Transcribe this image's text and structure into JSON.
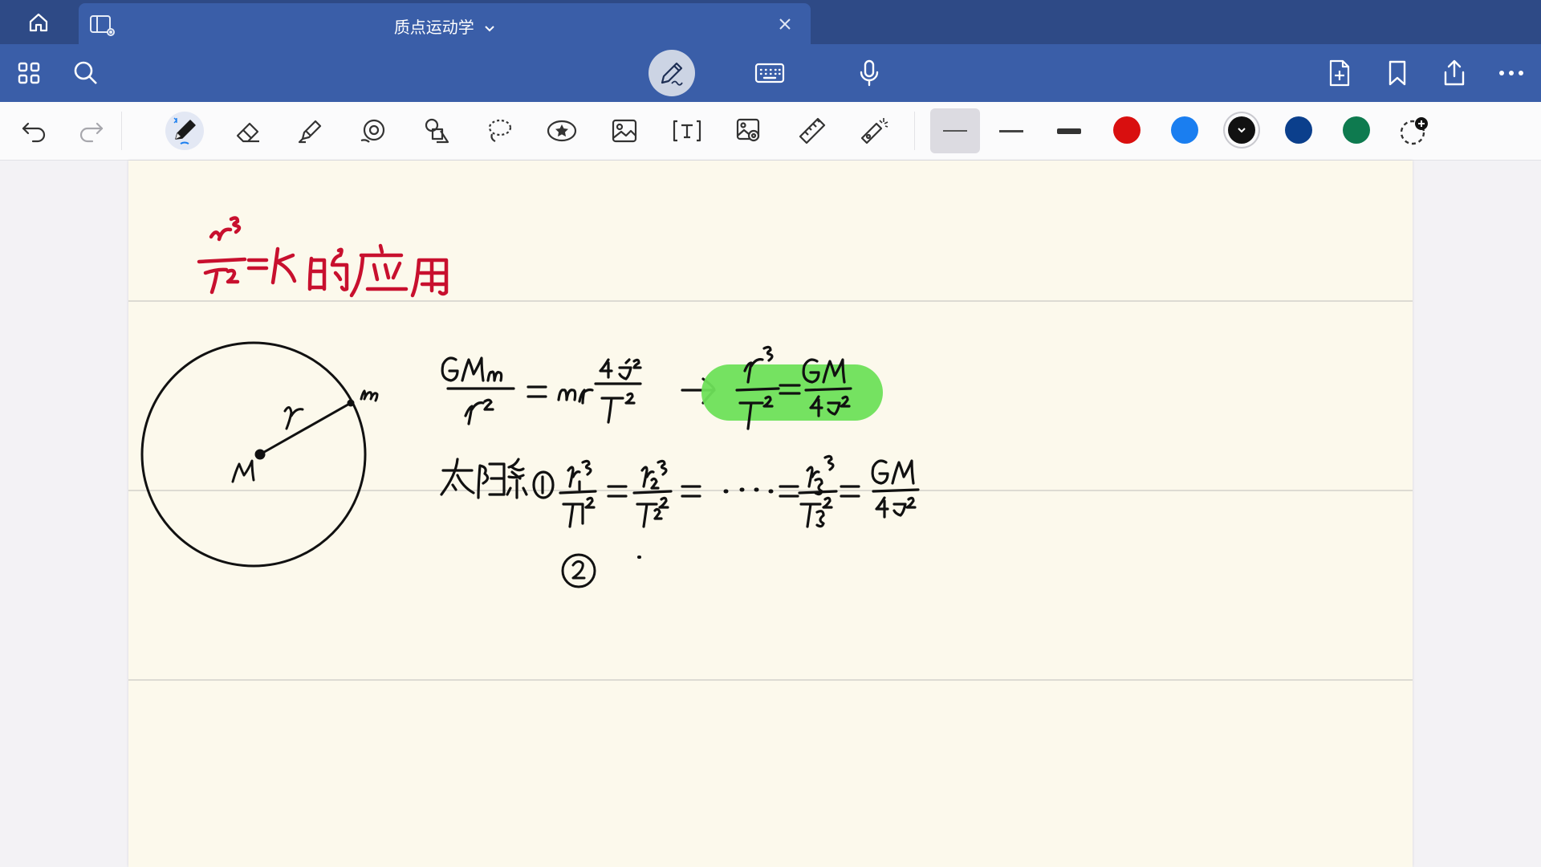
{
  "tab": {
    "title": "质点运动学"
  },
  "colors": {
    "tabbar_bg": "#2e4a86",
    "navbar_bg": "#3a5ea8",
    "page_bg": "#fcf9ec",
    "ink_red": "#c8102e",
    "ink_black": "#111111",
    "highlight": "#6ee05a"
  },
  "icons": {
    "tab": [
      "home-icon",
      "panel-icon",
      "chevron-down-icon",
      "close-icon"
    ],
    "nav_left": [
      "grid-icon",
      "search-icon"
    ],
    "nav_center": [
      "pen-mode-icon",
      "keyboard-icon",
      "microphone-icon"
    ],
    "nav_right": [
      "add-page-icon",
      "bookmark-icon",
      "share-icon",
      "more-icon"
    ],
    "tools": [
      "undo-icon",
      "redo-icon",
      "pen-icon",
      "eraser-icon",
      "highlighter-icon",
      "shape-icon",
      "elements-icon",
      "lasso-icon",
      "sticker-icon",
      "image-icon",
      "text-icon",
      "camera-icon",
      "ruler-icon",
      "laser-pointer-icon"
    ]
  },
  "stroke_widths": [
    "thin",
    "medium",
    "thick"
  ],
  "selected_stroke": "thin",
  "pen_colors": [
    "#d90f0f",
    "#1a7ef0",
    "#111111",
    "#0b3f8c",
    "#0e7a4f"
  ],
  "selected_color": "#111111"
}
